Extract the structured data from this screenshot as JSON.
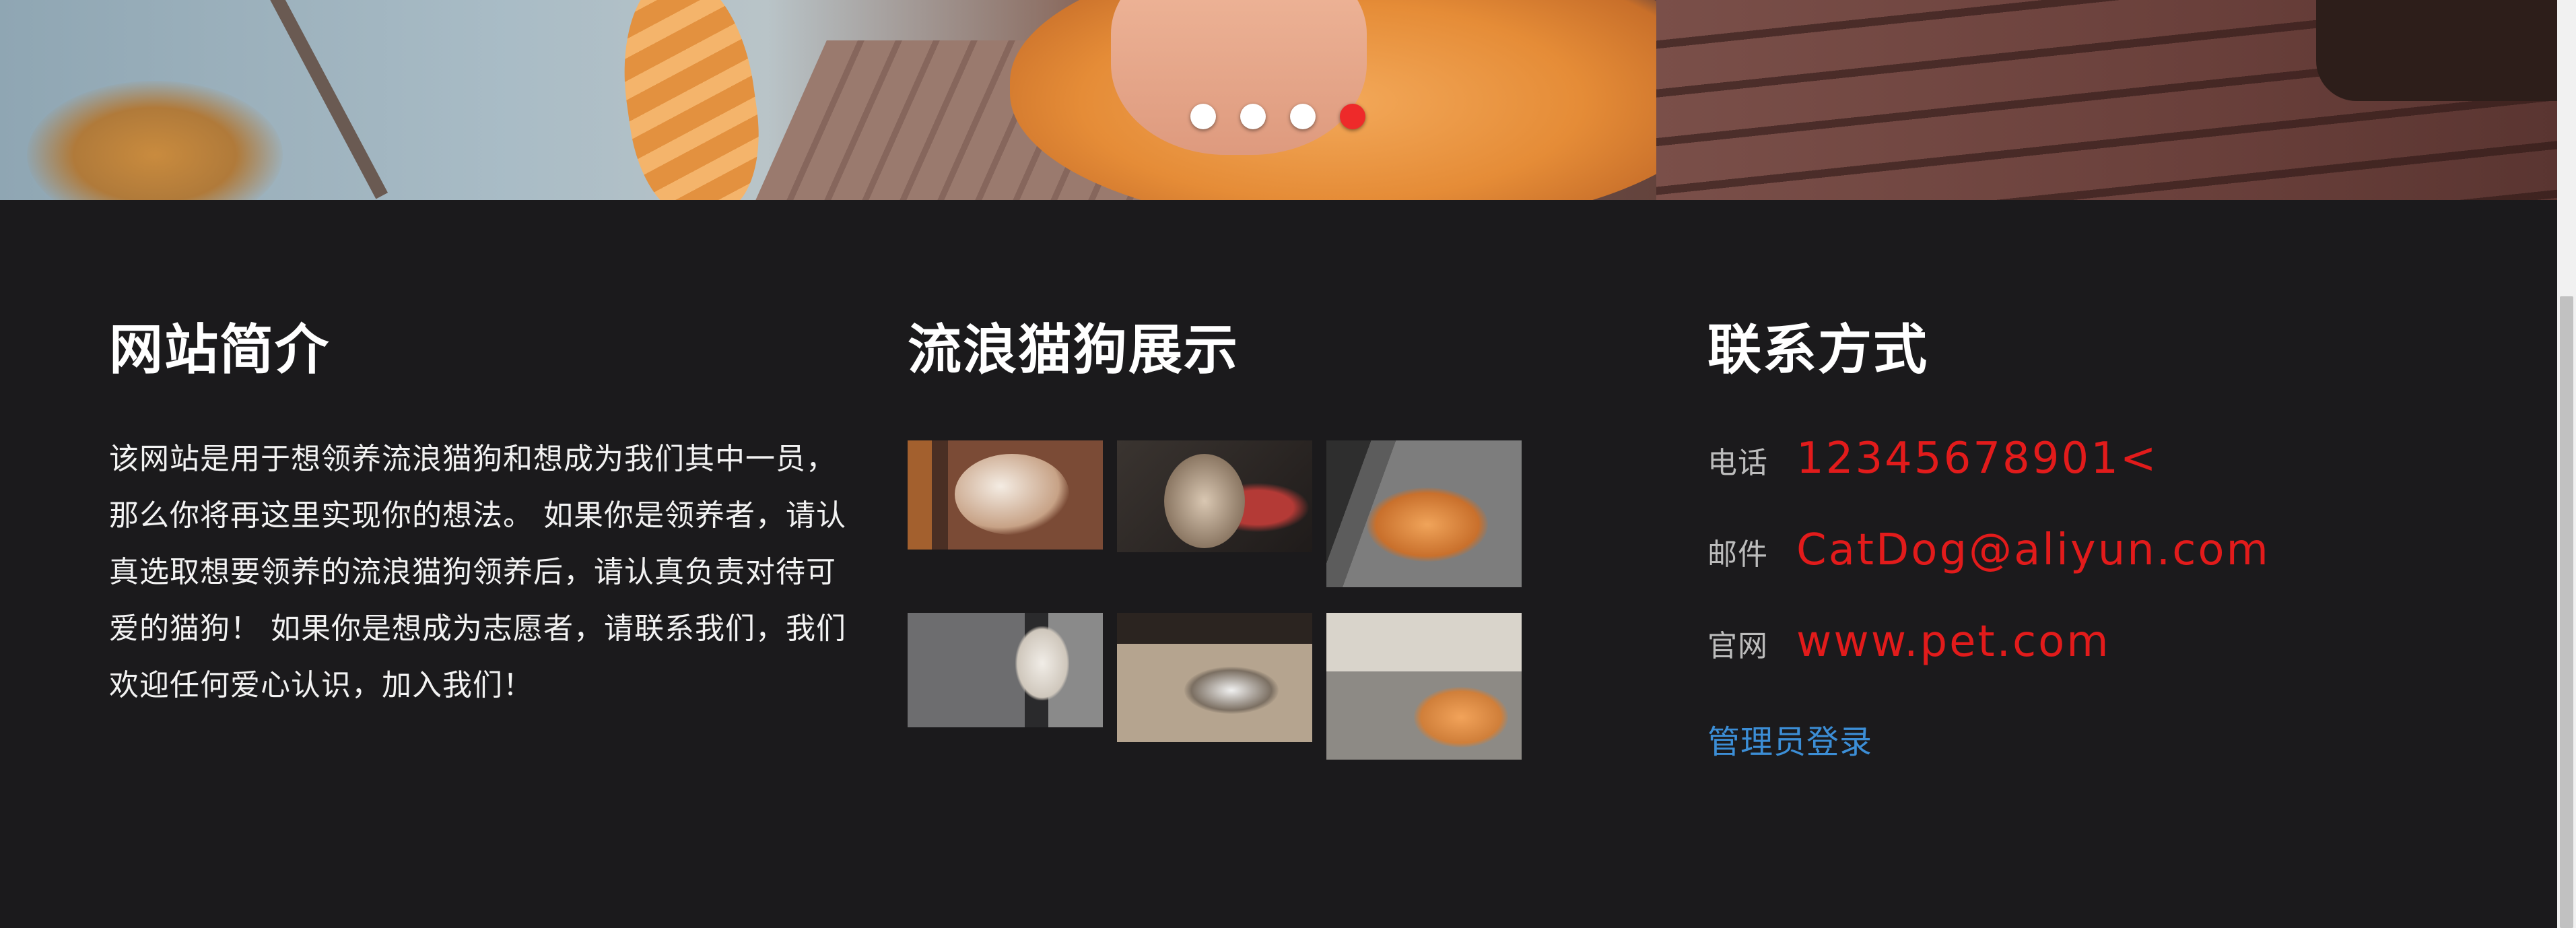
{
  "carousel": {
    "slide_count": 4,
    "active_index": 3,
    "active_dot_color": "#ee2a2a",
    "dot_color": "#ffffff"
  },
  "footer": {
    "background": "#1b1a1c",
    "intro": {
      "title": "网站简介",
      "text": "该网站是用于想领养流浪猫狗和想成为我们其中一员，那么你将再这里实现你的想法。 如果你是领养者，请认真选取想要领养的流浪猫狗领养后，请认真负责对待可爱的猫狗！ 如果你是想成为志愿者，请联系我们，我们欢迎任何爱心认识，加入我们！"
    },
    "gallery": {
      "title": "流浪猫狗展示"
    },
    "contact": {
      "title": "联系方式",
      "phone_label": "电话",
      "phone_value": "12345678901<",
      "email_label": "邮件",
      "email_value": "CatDog@aliyun.com",
      "site_label": "官网",
      "site_value": "www.pet.com",
      "admin_link": "管理员登录",
      "value_color": "#e21b1b",
      "link_color": "#3c8ed6"
    }
  }
}
